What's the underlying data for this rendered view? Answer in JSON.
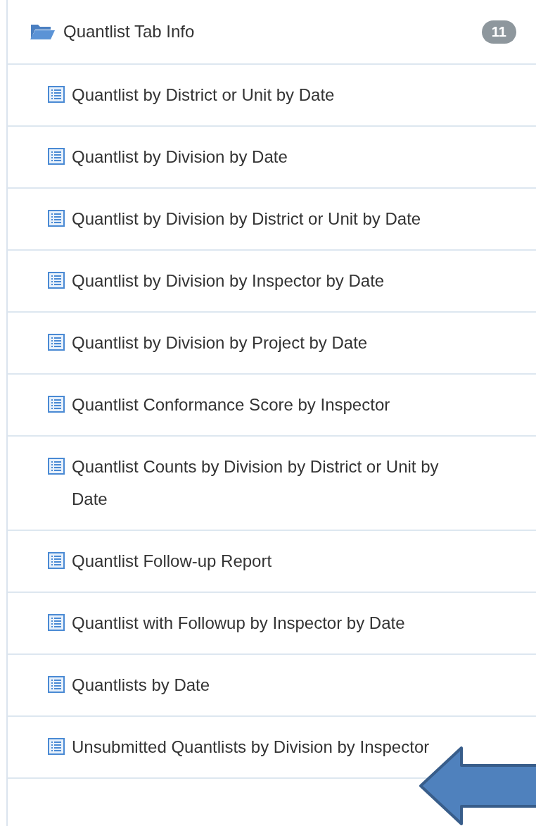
{
  "group": {
    "label": "Quantlist Tab Info",
    "count": "11",
    "expanded": true
  },
  "items": [
    {
      "label": "Quantlist by District or Unit by Date"
    },
    {
      "label": "Quantlist by Division by Date"
    },
    {
      "label": "Quantlist by Division by District or Unit by Date"
    },
    {
      "label": "Quantlist by Division by Inspector by Date"
    },
    {
      "label": "Quantlist by Division by Project by Date"
    },
    {
      "label": "Quantlist Conformance Score by Inspector"
    },
    {
      "label": "Quantlist Counts by Division by District or Unit by Date"
    },
    {
      "label": "Quantlist Follow-up Report"
    },
    {
      "label": "Quantlist with Followup by Inspector by Date"
    },
    {
      "label": "Quantlists by Date"
    },
    {
      "label": "Unsubmitted Quantlists by Division by Inspector"
    }
  ]
}
